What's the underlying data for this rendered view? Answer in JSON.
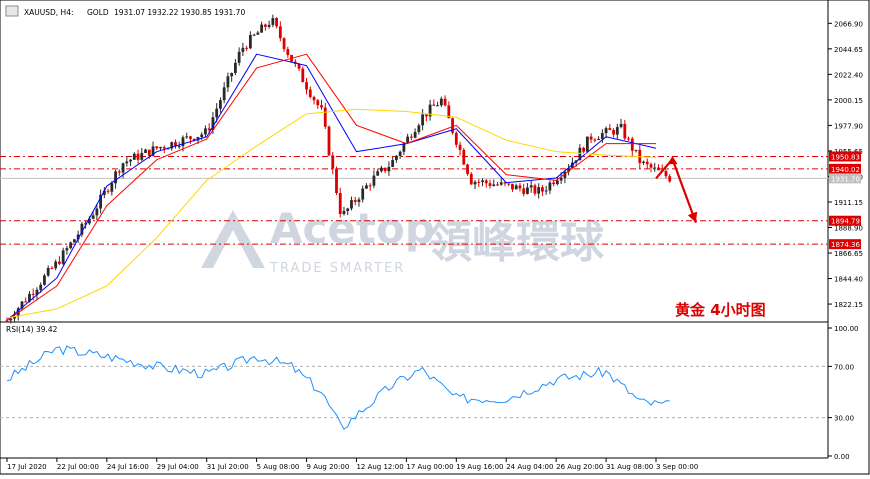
{
  "header": {
    "symbol": "XAUUSD, H4:",
    "description": "GOLD",
    "ohlc": "1931.07 1932.22 1930.85 1931.70"
  },
  "watermark": {
    "brand": "Acetop",
    "chinese": "領峰環球",
    "tagline": "TRADE SMARTER"
  },
  "annotation": {
    "label": "黄金 4小时图",
    "arrow_points": [
      [
        "3 Sep 00:00",
        1931.7
      ],
      [
        "3 Sep 04:00",
        1948.5
      ],
      [
        "3 Sep 20:00",
        1893.0
      ]
    ]
  },
  "colors": {
    "candle_up": "#2a2a2a",
    "candle_down": "#dd0000",
    "ma_fast": "#0000ff",
    "ma_mid": "#ff0000",
    "ma_slow": "#ffd700",
    "level_line": "#dd0000",
    "rsi": "#1e90ff",
    "annotation": "#dd0000"
  },
  "chart_data": [
    {
      "type": "candlestick",
      "symbol": "XAUUSD",
      "timeframe": "H4",
      "ylim": [
        1810,
        2082
      ],
      "yticks": [
        2066.9,
        2044.65,
        2022.4,
        2000.15,
        1977.9,
        1955.65,
        1933.4,
        1911.15,
        1888.9,
        1866.65,
        1844.4,
        1822.15
      ],
      "xticks": [
        "17 Jul 2020",
        "22 Jul 00:00",
        "24 Jul 16:00",
        "29 Jul 04:00",
        "31 Jul 20:00",
        "5 Aug 08:00",
        "9 Aug 20:00",
        "12 Aug 12:00",
        "17 Aug 00:00",
        "19 Aug 16:00",
        "24 Aug 04:00",
        "26 Aug 20:00",
        "31 Aug 08:00",
        "3 Sep 00:00"
      ],
      "close_path": [
        [
          "17 Jul 2020",
          1808
        ],
        [
          "22 Jul 00:00",
          1858
        ],
        [
          "24 Jul 16:00",
          1900
        ],
        [
          "24 Jul 16:00",
          1945
        ],
        [
          "29 Jul 04:00",
          1958
        ],
        [
          "31 Jul 20:00",
          1972
        ],
        [
          "5 Aug 08:00",
          2045
        ],
        [
          "5 Aug 08:00",
          2070
        ],
        [
          "9 Aug 20:00",
          2035
        ],
        [
          "9 Aug 20:00",
          1990
        ],
        [
          "12 Aug 12:00",
          1898
        ],
        [
          "12 Aug 12:00",
          1930
        ],
        [
          "17 Aug 00:00",
          1945
        ],
        [
          "17 Aug 00:00",
          1985
        ],
        [
          "19 Aug 16:00",
          2000
        ],
        [
          "19 Aug 16:00",
          1930
        ],
        [
          "24 Aug 04:00",
          1925
        ],
        [
          "26 Aug 20:00",
          1920
        ],
        [
          "26 Aug 20:00",
          1945
        ],
        [
          "31 Aug 08:00",
          1968
        ],
        [
          "31 Aug 08:00",
          1975
        ],
        [
          "3 Sep 00:00",
          1945
        ],
        [
          "3 Sep 00:00",
          1931.7
        ]
      ],
      "moving_averages": [
        {
          "color": "#0000ff",
          "points": [
            [
              "17 Jul 2020",
              1808
            ],
            [
              "22 Jul 00:00",
              1845
            ],
            [
              "24 Jul 16:00",
              1925
            ],
            [
              "29 Jul 04:00",
              1955
            ],
            [
              "31 Jul 20:00",
              1968
            ],
            [
              "5 Aug 08:00",
              2040
            ],
            [
              "9 Aug 20:00",
              2030
            ],
            [
              "12 Aug 12:00",
              1955
            ],
            [
              "17 Aug 00:00",
              1962
            ],
            [
              "19 Aug 16:00",
              1975
            ],
            [
              "24 Aug 04:00",
              1928
            ],
            [
              "26 Aug 20:00",
              1932
            ],
            [
              "31 Aug 08:00",
              1968
            ],
            [
              "3 Sep 00:00",
              1958
            ]
          ]
        },
        {
          "color": "#ff0000",
          "points": [
            [
              "17 Jul 2020",
              1808
            ],
            [
              "22 Jul 00:00",
              1838
            ],
            [
              "24 Jul 16:00",
              1908
            ],
            [
              "29 Jul 04:00",
              1948
            ],
            [
              "31 Jul 20:00",
              1966
            ],
            [
              "5 Aug 08:00",
              2028
            ],
            [
              "9 Aug 20:00",
              2040
            ],
            [
              "12 Aug 12:00",
              1978
            ],
            [
              "17 Aug 00:00",
              1962
            ],
            [
              "19 Aug 16:00",
              1978
            ],
            [
              "24 Aug 04:00",
              1935
            ],
            [
              "26 Aug 20:00",
              1930
            ],
            [
              "31 Aug 08:00",
              1962
            ],
            [
              "3 Sep 00:00",
              1962
            ]
          ]
        },
        {
          "color": "#ffd700",
          "points": [
            [
              "17 Jul 2020",
              1810
            ],
            [
              "22 Jul 00:00",
              1818
            ],
            [
              "24 Jul 16:00",
              1838
            ],
            [
              "29 Jul 04:00",
              1880
            ],
            [
              "31 Jul 20:00",
              1930
            ],
            [
              "5 Aug 08:00",
              1960
            ],
            [
              "9 Aug 20:00",
              1988
            ],
            [
              "12 Aug 12:00",
              1992
            ],
            [
              "17 Aug 00:00",
              1990
            ],
            [
              "19 Aug 16:00",
              1985
            ],
            [
              "24 Aug 04:00",
              1965
            ],
            [
              "26 Aug 20:00",
              1955
            ],
            [
              "31 Aug 08:00",
              1952
            ],
            [
              "3 Sep 00:00",
              1950
            ]
          ]
        }
      ],
      "horizontal_levels": [
        {
          "value": 1950.83,
          "label": "1950.83",
          "style": "dash-dot",
          "color": "#dd0000"
        },
        {
          "value": 1940.02,
          "label": "1940.02",
          "style": "dash-dot",
          "color": "#dd0000"
        },
        {
          "value": 1931.7,
          "label": "1931.70",
          "style": "solid",
          "color": "#c0c0c0"
        },
        {
          "value": 1894.79,
          "label": "1894.79",
          "style": "dash-dot",
          "color": "#dd0000"
        },
        {
          "value": 1874.36,
          "label": "1874.36",
          "style": "dash-dot",
          "color": "#dd0000"
        }
      ]
    },
    {
      "type": "line",
      "title": "RSI(14) 39.42",
      "ylim": [
        0,
        100
      ],
      "yticks": [
        100.0,
        70.0,
        30.0,
        0.0
      ],
      "levels": [
        70,
        30
      ],
      "series": [
        {
          "values": [
            [
              "17 Jul 2020",
              60
            ],
            [
              "22 Jul 00:00",
              84
            ],
            [
              "24 Jul 16:00",
              78
            ],
            [
              "29 Jul 04:00",
              70
            ],
            [
              "31 Jul 20:00",
              64
            ],
            [
              "5 Aug 08:00",
              78
            ],
            [
              "9 Aug 20:00",
              70
            ],
            [
              "9 Aug 20:00",
              50
            ],
            [
              "12 Aug 12:00",
              22
            ],
            [
              "12 Aug 12:00",
              42
            ],
            [
              "17 Aug 00:00",
              55
            ],
            [
              "17 Aug 00:00",
              68
            ],
            [
              "19 Aug 16:00",
              45
            ],
            [
              "24 Aug 04:00",
              45
            ],
            [
              "26 Aug 20:00",
              60
            ],
            [
              "31 Aug 08:00",
              66
            ],
            [
              "3 Sep 00:00",
              42
            ],
            [
              "3 Sep 00:00",
              39.42
            ]
          ]
        }
      ]
    }
  ]
}
